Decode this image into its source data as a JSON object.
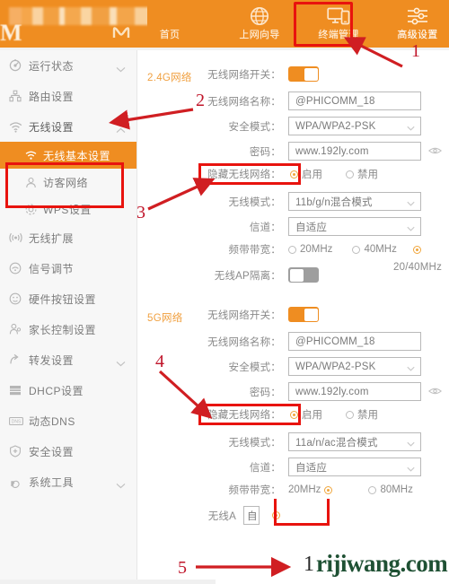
{
  "header": {
    "logo_mark": "M",
    "nav": [
      {
        "label": "首页",
        "icon": "home-icon",
        "active": false
      },
      {
        "label": "上网向导",
        "icon": "globe-icon",
        "active": false
      },
      {
        "label": "终端管理",
        "icon": "devices-icon",
        "active": false
      },
      {
        "label": "高级设置",
        "icon": "sliders-icon",
        "active": true
      }
    ]
  },
  "sidebar": {
    "items": [
      {
        "label": "运行状态",
        "icon": "status-icon",
        "chevron": "chevron-down",
        "level": "top",
        "selected": false
      },
      {
        "label": "路由设置",
        "icon": "router-icon",
        "chevron": "",
        "level": "top",
        "selected": false
      },
      {
        "label": "无线设置",
        "icon": "wifi-icon",
        "chevron": "chevron-up",
        "level": "top",
        "selected": false
      },
      {
        "label": "无线基本设置",
        "icon": "wifi-small-icon",
        "chevron": "",
        "level": "sub",
        "selected": true
      },
      {
        "label": "访客网络",
        "icon": "guest-icon",
        "chevron": "",
        "level": "sub",
        "selected": false
      },
      {
        "label": "WPS设置",
        "icon": "wps-icon",
        "chevron": "",
        "level": "sub",
        "selected": false
      },
      {
        "label": "无线扩展",
        "icon": "antenna-icon",
        "chevron": "",
        "level": "top",
        "selected": false
      },
      {
        "label": "信号调节",
        "icon": "signal-icon",
        "chevron": "",
        "level": "top",
        "selected": false
      },
      {
        "label": "硬件按钮设置",
        "icon": "button-icon",
        "chevron": "",
        "level": "top",
        "selected": false
      },
      {
        "label": "家长控制设置",
        "icon": "parent-icon",
        "chevron": "",
        "level": "top",
        "selected": false
      },
      {
        "label": "转发设置",
        "icon": "forward-icon",
        "chevron": "chevron-down",
        "level": "top",
        "selected": false
      },
      {
        "label": "DHCP设置",
        "icon": "dhcp-icon",
        "chevron": "",
        "level": "top",
        "selected": false
      },
      {
        "label": "动态DNS",
        "icon": "dns-icon",
        "chevron": "",
        "level": "top",
        "selected": false
      },
      {
        "label": "安全设置",
        "icon": "shield-icon",
        "chevron": "",
        "level": "top",
        "selected": false
      },
      {
        "label": "系统工具",
        "icon": "wrench-icon",
        "chevron": "chevron-down",
        "level": "top",
        "selected": false
      }
    ]
  },
  "main": {
    "band24": {
      "group_title": "2.4G网络",
      "switch_label": "无线网络开关：",
      "switch_state": "on",
      "ssid_label": "无线网络名称：",
      "ssid_value": "@PHICOMM_18",
      "security_label": "安全模式：",
      "security_value": "WPA/WPA2-PSK",
      "password_label": "密码：",
      "password_value": "www.192ly.com",
      "hide_label": "隐藏无线网络：",
      "hide_enable": "启用",
      "hide_disable": "禁用",
      "hide_selected": "启用",
      "mode_label": "无线模式：",
      "mode_value": "11b/g/n混合模式",
      "channel_label": "信道：",
      "channel_value": "自适应",
      "bandwidth_label": "频带带宽：",
      "bandwidth_opt1": "20MHz",
      "bandwidth_opt2": "40MHz",
      "bandwidth_opt3": "20/40MHz",
      "bandwidth_selected": "20/40MHz",
      "ap_isolate_label": "无线AP隔离：",
      "ap_isolate_state": "off"
    },
    "band5": {
      "group_title": "5G网络",
      "switch_label": "无线网络开关：",
      "switch_state": "on",
      "ssid_label": "无线网络名称：",
      "ssid_value": "@PHICOMM_18",
      "security_label": "安全模式：",
      "security_value": "WPA/WPA2-PSK",
      "password_label": "密码：",
      "password_value": "www.192ly.com",
      "hide_label": "隐藏无线网络：",
      "hide_enable": "启用",
      "hide_disable": "禁用",
      "hide_selected": "启用",
      "mode_label": "无线模式：",
      "mode_value": "11a/n/ac混合模式",
      "channel_label": "信道：",
      "channel_value": "自适应",
      "bandwidth_label": "频带带宽：",
      "bandwidth_opt1": "20MHz",
      "bandwidth_opt2": "80MHz",
      "bandwidth_selected": "20MHz",
      "ap_isolate_label": "无线A",
      "ap_isolate_value": "自"
    }
  },
  "annotations": {
    "steps": [
      "1",
      "2",
      "3",
      "4",
      "5"
    ]
  },
  "watermark": {
    "prefix": "1",
    "text": "rijiwang.com",
    "color": "#1f5134"
  },
  "colors": {
    "brand_orange": "#ef8d21",
    "annotation_red": "#e8130e",
    "group_title": "#f0a040"
  }
}
